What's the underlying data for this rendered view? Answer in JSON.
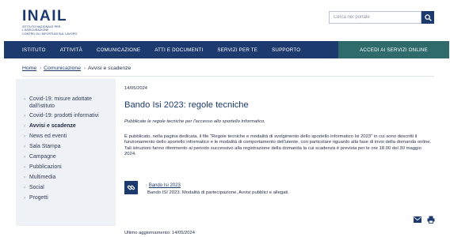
{
  "brand": {
    "logo_text": "INAIL",
    "logo_subtitle_line1": "Istituto nazionale per l'assicurazione",
    "logo_subtitle_line2": "contro gli infortuni sul lavoro"
  },
  "search": {
    "placeholder": "Cerca nel portale",
    "icon": "search-icon"
  },
  "nav": {
    "items": [
      "Istituto",
      "Attività",
      "Comunicazione",
      "Atti e documenti",
      "Servizi per te",
      "Supporto"
    ],
    "cta": "Accedi ai servizi online",
    "colors": {
      "bar": "#1d3a6e",
      "cta": "#2f6b6b"
    }
  },
  "breadcrumb": {
    "home": "Home",
    "section": "Comunicazione",
    "current": "Avvisi e scadenze"
  },
  "sidebar": {
    "items": [
      {
        "label": "Covid-19: misure adottate dall'istituto",
        "active": false
      },
      {
        "label": "Covid-19: prodotti informativi",
        "active": false
      },
      {
        "label": "Avvisi e scadenze",
        "active": true
      },
      {
        "label": "News ed eventi",
        "active": false
      },
      {
        "label": "Sala Stampa",
        "active": false
      },
      {
        "label": "Campagne",
        "active": false
      },
      {
        "label": "Pubblicazioni",
        "active": false
      },
      {
        "label": "Multimedia",
        "active": false
      },
      {
        "label": "Social",
        "active": false
      },
      {
        "label": "Progetti",
        "active": false
      }
    ]
  },
  "article": {
    "date": "14/05/2024",
    "title": "Bando Isi 2023: regole tecniche",
    "lead": "Pubblicate le regole tecniche per l'accesso allo sportello informatico.",
    "body_p1": "È pubblicato, nella pagina dedicata, il file \"Regole tecniche e modalità di svolgimento dello sportello informatico Isi 2023\" in cui sono descritti il funzionamento dello sportello informatico e le modalità di comportamento dell'utente, con particolare riguardo alla fase di invio della domanda online.",
    "body_p2": "Tali istruzioni fanno riferimento al periodo successivo alla registrazione della domanda la cui scadenza è prevista per le ore 18.00 del 30 maggio 2024.",
    "attachment_link": "Bando Isi 2023",
    "attachment_desc": "Bando ISI 2023. Modalità di partecipazione, Avvisi pubblici e allegati.",
    "last_update": "Ultimo aggiornamento: 14/05/2024"
  },
  "icons": {
    "attachment": "link-icon",
    "email": "envelope-icon",
    "print": "printer-icon"
  }
}
